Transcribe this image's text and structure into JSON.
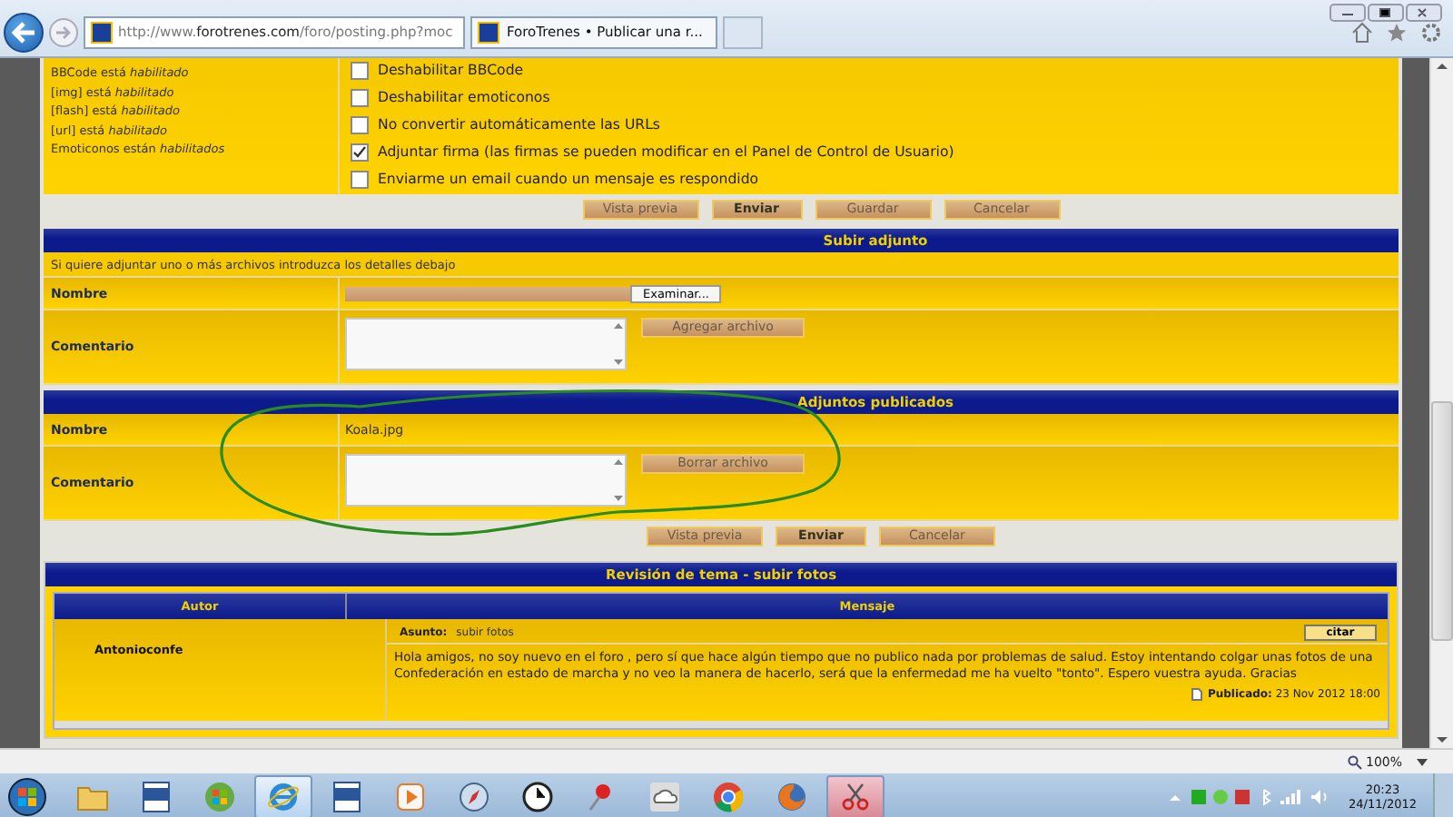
{
  "browser": {
    "url": "http://www.**forotrenes.com**/foro/posting.php?moc",
    "tab_title": "ForoTrenes • Publicar una r...",
    "zoom": "100%"
  },
  "options": {
    "status_lines": [
      "BBCode está *habilitado*",
      "[img] está *habilitado*",
      "[flash] está *habilitado*",
      "[url] está *habilitado*",
      "Emoticonos están *habilitados*"
    ],
    "checkboxes": [
      {
        "label": "Deshabilitar BBCode",
        "checked": false
      },
      {
        "label": "Deshabilitar emoticonos",
        "checked": false
      },
      {
        "label": "No convertir automáticamente las URLs",
        "checked": false
      },
      {
        "label": "Adjuntar firma (las firmas se pueden modificar en el Panel de Control de Usuario)",
        "checked": true
      },
      {
        "label": "Enviarme un email cuando un mensaje es respondido",
        "checked": false
      }
    ],
    "buttons": [
      {
        "label": "Vista previa",
        "primary": false
      },
      {
        "label": "Enviar",
        "primary": true
      },
      {
        "label": "Guardar",
        "primary": false
      },
      {
        "label": "Cancelar",
        "primary": false
      }
    ]
  },
  "upload": {
    "header": "Subir adjunto",
    "hint": "Si quiere adjuntar uno o más archivos introduzca los detalles debajo",
    "name_label": "Nombre",
    "browse_button": "Examinar...",
    "comment_label": "Comentario",
    "add_button": "Agregar archivo"
  },
  "published": {
    "header": "Adjuntos publicados",
    "name_label": "Nombre",
    "filename": "Koala.jpg",
    "comment_label": "Comentario",
    "delete_button": "Borrar archivo",
    "buttons": [
      {
        "label": "Vista previa",
        "primary": false
      },
      {
        "label": "Enviar",
        "primary": true
      },
      {
        "label": "Cancelar",
        "primary": false
      }
    ]
  },
  "review": {
    "header": "Revisión de tema - subir fotos",
    "columns": [
      "Autor",
      "Mensaje"
    ],
    "author": "Antonioconfe",
    "subject_label": "Asunto:",
    "subject": "subir fotos",
    "quote_button": "citar",
    "message": "Hola amigos, no soy nuevo en el foro , pero sí que hace algún tiempo que no publico nada por problemas de salud. Estoy intentando colgar unas fotos de una Confederación en estado de marcha y no veo la manera de hacerlo, será que la enfermedad me ha vuelto \"tonto\". Espero vuestra ayuda. Gracias",
    "posted": "**Publicado:** 23 Nov 2012 18:00"
  },
  "taskbar": {
    "apps": [
      {
        "kind": "folder",
        "selected": false
      },
      {
        "kind": "word",
        "selected": false
      },
      {
        "kind": "windows",
        "selected": false
      },
      {
        "kind": "ie",
        "selected": true
      },
      {
        "kind": "doc",
        "selected": false
      },
      {
        "kind": "player",
        "selected": false
      },
      {
        "kind": "compass",
        "selected": false
      },
      {
        "kind": "clock",
        "selected": false
      },
      {
        "kind": "pin",
        "selected": false
      },
      {
        "kind": "cloud",
        "selected": false
      },
      {
        "kind": "chrome",
        "selected": false
      },
      {
        "kind": "firefox",
        "selected": false
      },
      {
        "kind": "scissors",
        "selected": true
      }
    ],
    "time": "20:23",
    "date": "24/11/2012"
  }
}
